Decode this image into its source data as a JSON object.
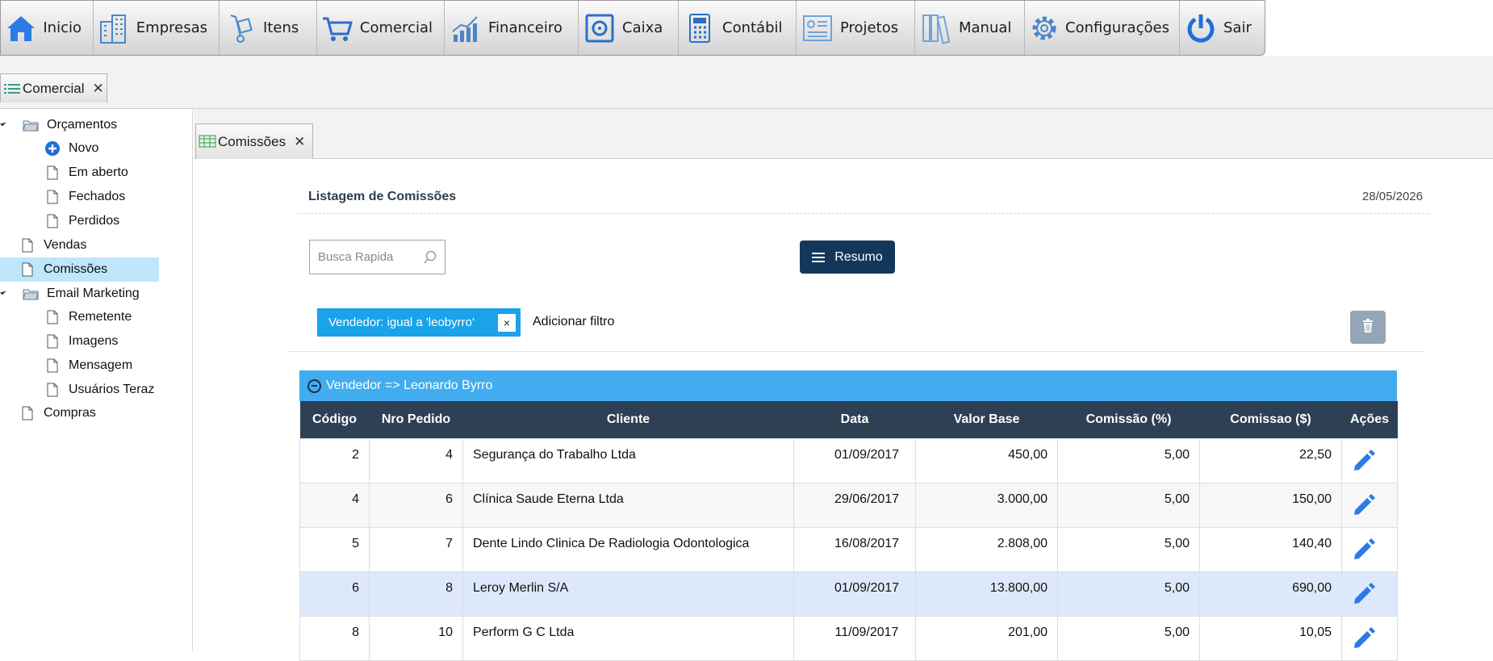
{
  "toolbar": {
    "items": [
      {
        "label": "Inicio",
        "icon": "home-icon"
      },
      {
        "label": "Empresas",
        "icon": "buildings-icon"
      },
      {
        "label": "Itens",
        "icon": "hand-truck-icon"
      },
      {
        "label": "Comercial",
        "icon": "shopping-cart-icon"
      },
      {
        "label": "Financeiro",
        "icon": "growth-chart-icon"
      },
      {
        "label": "Caixa",
        "icon": "safe-icon"
      },
      {
        "label": "Contábil",
        "icon": "calculator-icon"
      },
      {
        "label": "Projetos",
        "icon": "projects-icon"
      },
      {
        "label": "Manual",
        "icon": "books-icon"
      },
      {
        "label": "Configurações",
        "icon": "gear-icon"
      },
      {
        "label": "Sair",
        "icon": "power-icon"
      }
    ]
  },
  "main_tab": {
    "label": "Comercial",
    "close": "✕"
  },
  "sidebar": {
    "orcamentos": "Orçamentos",
    "novo": "Novo",
    "em_aberto": "Em aberto",
    "fechados": "Fechados",
    "perdidos": "Perdidos",
    "vendas": "Vendas",
    "comissoes": "Comissões",
    "email_marketing": "Email Marketing",
    "remetente": "Remetente",
    "imagens": "Imagens",
    "mensagem": "Mensagem",
    "usuarios_teraz": "Usuários Teraz",
    "compras": "Compras"
  },
  "sub_tab": {
    "label": "Comissões",
    "close": "✕"
  },
  "page": {
    "title": "Listagem de Comissões",
    "date": "28/05/2026",
    "search_placeholder": "Busca Rapida",
    "resumo_label": "Resumo",
    "filter_chip": "Vendedor: igual a 'leobyrro'",
    "filter_chip_close": "×",
    "add_filter": "Adicionar filtro"
  },
  "grid": {
    "group_label": "Vendedor => Leonardo Byrro",
    "columns": {
      "codigo": "Código",
      "nro_pedido": "Nro Pedido",
      "cliente": "Cliente",
      "data": "Data",
      "valor_base": "Valor Base",
      "comissao_pct": "Comissão (%)",
      "comissao_val": "Comissao ($)",
      "acoes": "Ações"
    },
    "rows": [
      {
        "codigo": "2",
        "nro_pedido": "4",
        "cliente": "Segurança do Trabalho Ltda",
        "data": "01/09/2017",
        "valor_base": "450,00",
        "comissao_pct": "5,00",
        "comissao_val": "22,50"
      },
      {
        "codigo": "4",
        "nro_pedido": "6",
        "cliente": "Clínica Saude Eterna Ltda",
        "data": "29/06/2017",
        "valor_base": "3.000,00",
        "comissao_pct": "5,00",
        "comissao_val": "150,00"
      },
      {
        "codigo": "5",
        "nro_pedido": "7",
        "cliente": "Dente Lindo Clinica De Radiologia Odontologica",
        "data": "16/08/2017",
        "valor_base": "2.808,00",
        "comissao_pct": "5,00",
        "comissao_val": "140,40"
      },
      {
        "codigo": "6",
        "nro_pedido": "8",
        "cliente": "Leroy Merlin S/A",
        "data": "01/09/2017",
        "valor_base": "13.800,00",
        "comissao_pct": "5,00",
        "comissao_val": "690,00"
      },
      {
        "codigo": "8",
        "nro_pedido": "10",
        "cliente": "Perform G C Ltda",
        "data": "11/09/2017",
        "valor_base": "201,00",
        "comissao_pct": "5,00",
        "comissao_val": "10,05"
      }
    ]
  },
  "colors": {
    "accent": "#41adf0",
    "header_dark": "#2e4053",
    "button_dark": "#13375b",
    "chip": "#1aa3e8",
    "selection": "#bfe6fb"
  }
}
